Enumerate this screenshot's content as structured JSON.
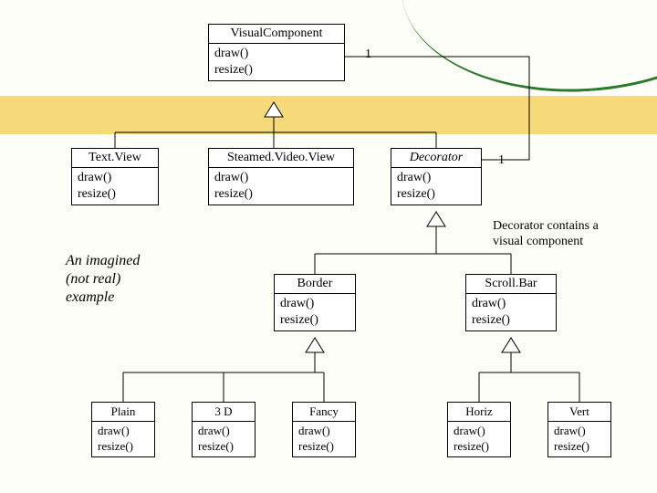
{
  "classes": {
    "visualComponent": {
      "name": "VisualComponent",
      "op1": "draw()",
      "op2": "resize()"
    },
    "textView": {
      "name": "Text.View",
      "op1": "draw()",
      "op2": "resize()"
    },
    "steamedVideoView": {
      "name": "Steamed.Video.View",
      "op1": "draw()",
      "op2": "resize()"
    },
    "decorator": {
      "name": "Decorator",
      "op1": "draw()",
      "op2": "resize()"
    },
    "border": {
      "name": "Border",
      "op1": "draw()",
      "op2": "resize()"
    },
    "scrollBar": {
      "name": "Scroll.Bar",
      "op1": "draw()",
      "op2": "resize()"
    },
    "plain": {
      "name": "Plain",
      "op1": "draw()",
      "op2": "resize()"
    },
    "threeD": {
      "name": "3 D",
      "op1": "draw()",
      "op2": "resize()"
    },
    "fancy": {
      "name": "Fancy",
      "op1": "draw()",
      "op2": "resize()"
    },
    "horiz": {
      "name": "Horiz",
      "op1": "draw()",
      "op2": "resize()"
    },
    "vert": {
      "name": "Vert",
      "op1": "draw()",
      "op2": "resize()"
    }
  },
  "multiplicity": {
    "topRight": "1",
    "decoratorRight": "1"
  },
  "notes": {
    "imagined1": "An imagined",
    "imagined2": "(not real)",
    "imagined3": "example",
    "decoratorContains1": "Decorator contains a",
    "decoratorContains2": "visual component"
  }
}
